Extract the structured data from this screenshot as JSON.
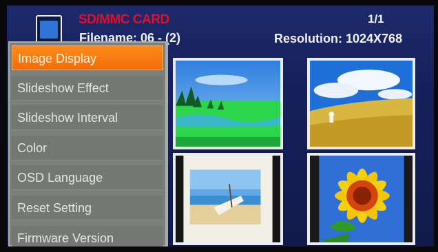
{
  "header": {
    "source_label": "SD/MMC CARD",
    "filename_text": "Filename: 06 - (2)",
    "page_indicator": "1/1",
    "resolution_text": "Resolution: 1024X768",
    "card_icon": "sd-card-icon"
  },
  "menu": {
    "items": [
      {
        "label": "Image Display"
      },
      {
        "label": "Slideshow Effect"
      },
      {
        "label": "Slideshow Interval"
      },
      {
        "label": "Color"
      },
      {
        "label": "OSD Language"
      },
      {
        "label": "Reset Setting"
      },
      {
        "label": "Firmware Version"
      }
    ],
    "selected_index": 0,
    "highlight_color": "#f57a0c"
  },
  "thumbnails": [
    {
      "name": "landscape-trees-lake"
    },
    {
      "name": "sky-field-person"
    },
    {
      "name": "beach-boat"
    },
    {
      "name": "sunflower"
    }
  ]
}
